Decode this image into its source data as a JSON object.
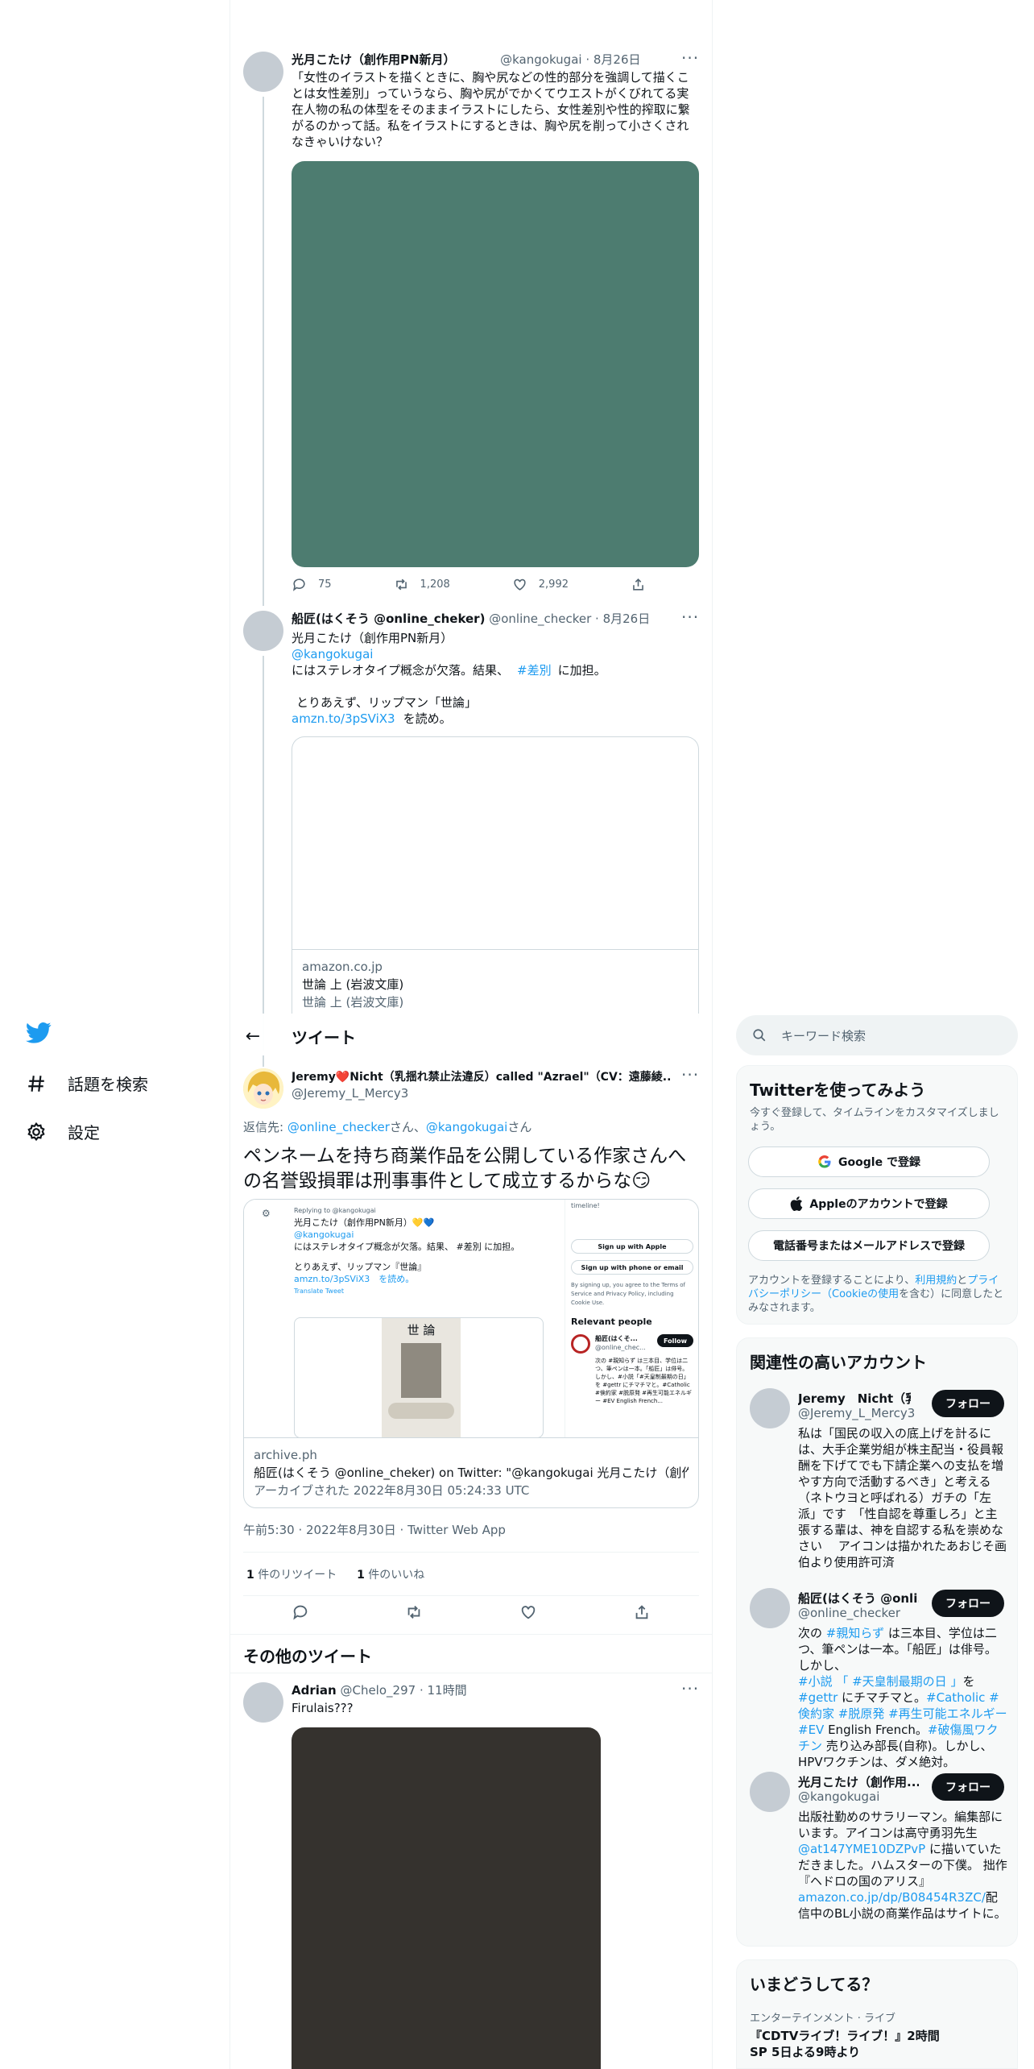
{
  "thread": {
    "tweet1": {
      "name": "光月こたけ（創作用PN新月）",
      "handle": "@kangokugai",
      "date": "8月26日",
      "text": "「女性のイラストを描くときに、胸や尻などの性的部分を強調して描くことは女性差別」っていうなら、胸や尻がでかくてウエストがくびれてる実在人物の私の体型をそのままイラストにしたら、女性差別や性的搾取に繋がるのかって話。私をイラストにするときは、胸や尻を削って小さくされなきゃいけない？",
      "image_color": "#4d7c70",
      "replies": "75",
      "retweets": "1,208",
      "likes": "2,992"
    },
    "tweet2": {
      "name": "船匠(はくそう @online_cheker)",
      "handle": "@online_checker",
      "date": "8月26日",
      "line1": "光月こたけ（創作用PN新月）",
      "mention": "@kangokugai",
      "line3a": "にはステレオタイプ概念が欠落。結果、",
      "hashtag": "#差別",
      "line3b": "に加担。",
      "line4": "とりあえず、リップマン「世論」",
      "link": "amzn.to/3pSViX3",
      "line5b": "を読め。",
      "card_domain": "amazon.co.jp",
      "card_title": "世論 上 (岩波文庫)",
      "card_desc": "世論 上 (岩波文庫)"
    }
  },
  "nav": {
    "explore": "話題を検索",
    "settings": "設定"
  },
  "header": {
    "title": "ツイート"
  },
  "main_tweet": {
    "name": "Jeremy❤️Nicht（乳揺れ禁止法違反）called \"Azrael\"（CV：遠藤綾...",
    "handle": "@Jeremy_L_Mercy3",
    "reply_prefix": "返信先: ",
    "reply_to1": "@online_checker",
    "reply_san1": "さん、",
    "reply_to2": "@kangokugai",
    "reply_san2": "さん",
    "text": "ペンネームを持ち商業作品を公開している作家さんへの名誉毀損罪は刑事事件として成立するからな😏",
    "card": {
      "domain": "archive.ph",
      "title": "船匠(はくそう @online_cheker) on Twitter: \"@kangokugai 光月こたけ（創作用...",
      "desc": "アーカイブされた 2022年8月30日 05:24:33 UTC",
      "shot_replying": "Replying to @kangokugai",
      "shot_line1": "光月こたけ（創作用PN新月）💛💙",
      "shot_mention": "@kangokugai",
      "shot_line3": "にはステレオタイプ概念が欠落。結果、 #差別 に加担。",
      "shot_line4": "とりあえず、リップマン『世論』",
      "shot_link": "amzn.to/3pSViX3　を読め。",
      "shot_translate": "Translate Tweet",
      "shot_book": "世 論",
      "shot_timeline": "timeline!",
      "shot_apple": "Sign up with Apple",
      "shot_phone": "Sign up with phone or email",
      "shot_terms": "By signing up, you agree to the Terms of Service and Privacy Policy, including Cookie Use.",
      "shot_relevant": "Relevant people",
      "shot_person": "船匠(はくそ...",
      "shot_person_handle": "@online_chec...",
      "shot_follow": "Follow",
      "shot_bio": "次の #親知らず は三本目、学位は二つ、筆ペンは一本。「船匠」は俳号。しかし、#小説「#天皇制最期の日」を #gettr にチマチマと。#Catholic #倹約家 #脱原発 #再生可能エネルギー #EV English French..."
    },
    "timestamp": "午前5:30 · 2022年8月30日 · Twitter Web App",
    "retweet_count": "1",
    "retweet_label": " 件のリツイート",
    "like_count": "1",
    "like_label": " 件のいいね"
  },
  "more_tweets": {
    "title": "その他のツイート",
    "tweet": {
      "name": "Adrian",
      "handle": "@Chelo_297",
      "date": "11時間",
      "text": "Firulais???",
      "image_color": "#35322e"
    }
  },
  "sidebar": {
    "search_placeholder": "キーワード検索",
    "signup": {
      "title": "Twitterを使ってみよう",
      "subtitle": "今すぐ登録して、タイムラインをカスタマイズしましょう。",
      "google": "Google で登録",
      "apple": "Appleのアカウントで登録",
      "phone": "電話番号またはメールアドレスで登録",
      "legal_a": "アカウントを登録することにより、",
      "legal_terms": "利用規約",
      "legal_b": "と",
      "legal_privacy": "プライバシーポリシー（Cookieの使用",
      "legal_c": "を含む）に同意したとみなされます。"
    },
    "relevant": {
      "title": "関連性の高いアカウント",
      "follow": "フォロー",
      "accounts": [
        {
          "name": "Jeremy　Nicht（乳...",
          "handle": "@Jeremy_L_Mercy3",
          "bio": "私は「国民の収入の底上げを計るには、大手企業労組が株主配当・役員報酬を下げてでも下請企業への支払を増やす方向で活動するべき」と考える（ネトウヨと呼ばれる）ガチの「左派」です　「性自認を尊重しろ」と主張する輩は、神を自認する私を崇めなさい　 アイコンは描かれたあおじそ画伯より使用許可済"
        },
        {
          "name": "船匠(はくそう @onli...",
          "handle": "@online_checker",
          "bio_a": "次の ",
          "bio_tag1": "#親知らず",
          "bio_b": " は三本目、学位は二つ、筆ペンは一本。「船匠」は俳号。しかし、",
          "bio_tag2": "#小説 「 #天皇制最期の日 」",
          "bio_c": "を ",
          "bio_tag3": "#gettr",
          "bio_d": " にチマチマと。",
          "bio_tag4": "#Catholic #倹約家 #脱原発 #再生可能エネルギー #EV",
          "bio_e": " English French。",
          "bio_tag5": "#破傷風ワクチン",
          "bio_f": " 売り込み部長(自称)。しかし、HPVワクチンは、ダメ絶対。"
        },
        {
          "name": "光月こたけ（創作用...",
          "handle": "@kangokugai",
          "bio_a": "出版社勤めのサラリーマン。編集部にいます。アイコンは高守勇羽先生",
          "bio_link1": "@at147YME10DZPvP",
          "bio_b": " に描いていただきました。ハムスターの下僕。 拙作『ヘドロの国のアリス』",
          "bio_link2": "amazon.co.jp/dp/B08454R3ZC/",
          "bio_c": "配信中のBL小説の商業作品はサイトに。"
        }
      ]
    },
    "trends": {
      "title": "いまどうしてる？",
      "category": "エンターテインメント · ライブ",
      "headline": "『CDTVライブ！ライブ！』2時間SP 5日よる9時より"
    }
  },
  "colors": {
    "accent": "#1d9bf0",
    "text": "#0f1419",
    "muted": "#536471"
  }
}
